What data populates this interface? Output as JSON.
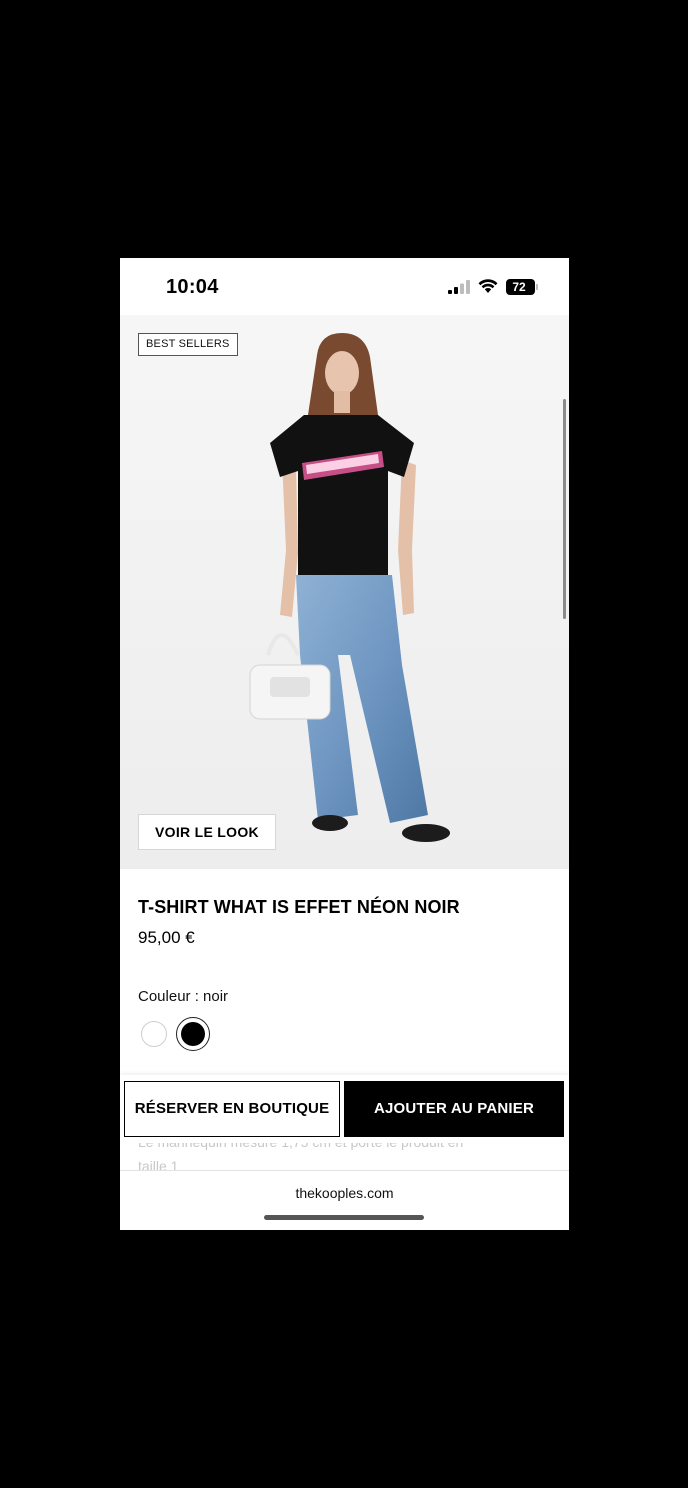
{
  "status_bar": {
    "time": "10:04",
    "battery": "72",
    "icons": [
      "signal-icon",
      "wifi-icon",
      "battery-icon"
    ]
  },
  "product": {
    "badge": "BEST SELLERS",
    "look_button": "VOIR LE LOOK",
    "title": "T-SHIRT WHAT IS EFFET NÉON NOIR",
    "price": "95,00 €",
    "color_label": "Couleur : noir",
    "colors": [
      "#ffffff",
      "#000000"
    ],
    "description_line_1": "Le mannequin mesure 1,75 cm et porte le produit en",
    "description_line_2": "taille 1"
  },
  "actions": {
    "reserve": "RÉSERVER EN BOUTIQUE",
    "add_to_cart": "AJOUTER AU PANIER"
  },
  "browser": {
    "url": "thekooples.com"
  }
}
